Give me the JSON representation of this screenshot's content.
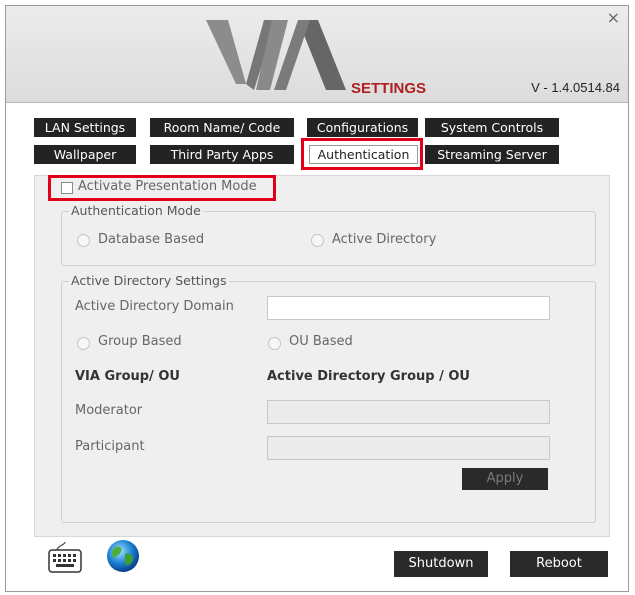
{
  "header": {
    "close_symbol": "×",
    "settings_label": "SETTINGS",
    "version": "V - 1.4.0514.84"
  },
  "tabs_row1": [
    {
      "label": "LAN Settings"
    },
    {
      "label": "Room Name/ Code"
    },
    {
      "label": "Configurations"
    },
    {
      "label": "System Controls"
    }
  ],
  "tabs_row2": [
    {
      "label": "Wallpaper"
    },
    {
      "label": "Third Party Apps"
    },
    {
      "label": "Authentication",
      "active": true
    },
    {
      "label": "Streaming Server"
    }
  ],
  "presentation_mode": {
    "label": "Activate Presentation Mode",
    "checked": false
  },
  "auth_mode": {
    "legend": "Authentication Mode",
    "options": [
      "Database Based",
      "Active Directory"
    ]
  },
  "ad_settings": {
    "legend": "Active Directory Settings",
    "domain_label": "Active Directory Domain",
    "domain_value": "",
    "options": [
      "Group Based",
      "OU Based"
    ],
    "col_via": "VIA Group/ OU",
    "col_ad": "Active Directory Group / OU",
    "moderator_label": "Moderator",
    "moderator_value": "",
    "participant_label": "Participant",
    "participant_value": "",
    "apply_label": "Apply"
  },
  "footer": {
    "keyboard_icon": "keyboard-icon",
    "globe_icon": "globe-icon",
    "shutdown_label": "Shutdown",
    "reboot_label": "Reboot"
  },
  "colors": {
    "tab_bg": "#232323",
    "highlight": "#e0001a",
    "brand_red": "#b0201f"
  }
}
